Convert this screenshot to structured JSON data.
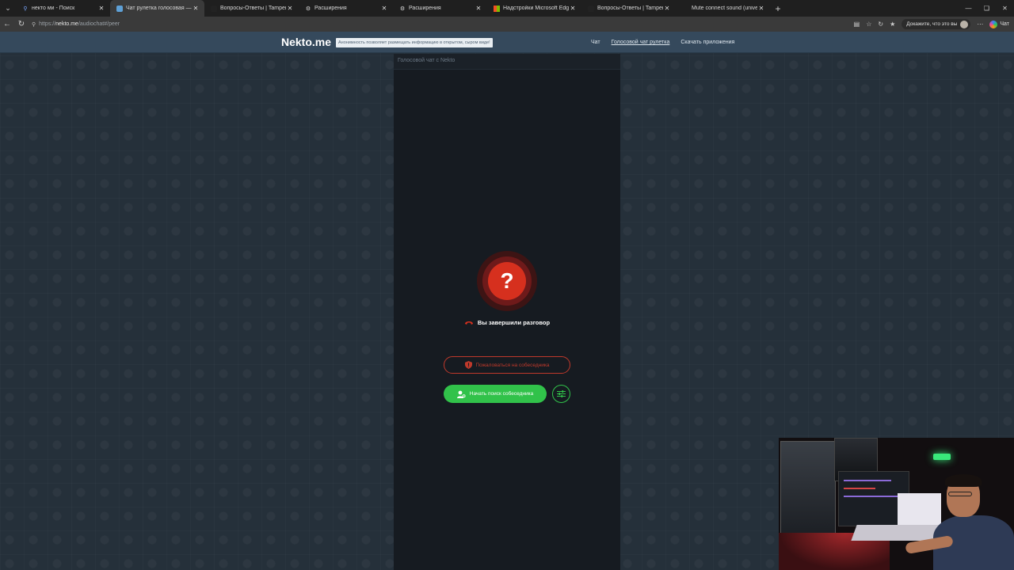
{
  "browser": {
    "tabs": [
      {
        "title": "некто ми - Поиск",
        "icon": "search-icon",
        "active": false
      },
      {
        "title": "Чат рулетка голосовая — Nekto.me",
        "icon": "nekto-favicon",
        "active": true
      },
      {
        "title": "Вопросы-Ответы | Tampermonkey",
        "icon": "tampermonkey-icon",
        "active": false
      },
      {
        "title": "Расширения",
        "icon": "extensions-icon",
        "active": false
      },
      {
        "title": "Расширения",
        "icon": "extensions-icon",
        "active": false
      },
      {
        "title": "Надстройки Microsoft Edge",
        "icon": "microsoft-icon",
        "active": false
      },
      {
        "title": "Вопросы-Ответы | Tampermonkey",
        "icon": "tampermonkey-icon",
        "active": false
      },
      {
        "title": "Mute connect sound (universal)",
        "icon": "script-icon",
        "active": false
      }
    ],
    "url_prefix": "https://",
    "url_host": "nekto.me",
    "url_path": "/audiochat#/peer",
    "profile_label": "Докажите, что это вы",
    "copilot_label": "Чат"
  },
  "site": {
    "brand": "Nekto.me",
    "notice": "Анонимность позволяет размещать информацию в открытом, сыром виде!",
    "nav": [
      {
        "label": "Чат",
        "active": false
      },
      {
        "label": "Голосовой чат рулетка",
        "active": true
      },
      {
        "label": "Скачать приложения",
        "active": false
      }
    ]
  },
  "chat": {
    "title": "Голосовой чат с Nekto",
    "status_symbol": "?",
    "ended_text": "Вы завершили разговор",
    "report_button": "Пожаловаться на собеседника",
    "search_button": "Начать поиск собеседника",
    "colors": {
      "accent_red": "#d6301e",
      "accent_green": "#31c24a",
      "header_bg": "#35495c",
      "panel_bg": "#161b21"
    }
  }
}
